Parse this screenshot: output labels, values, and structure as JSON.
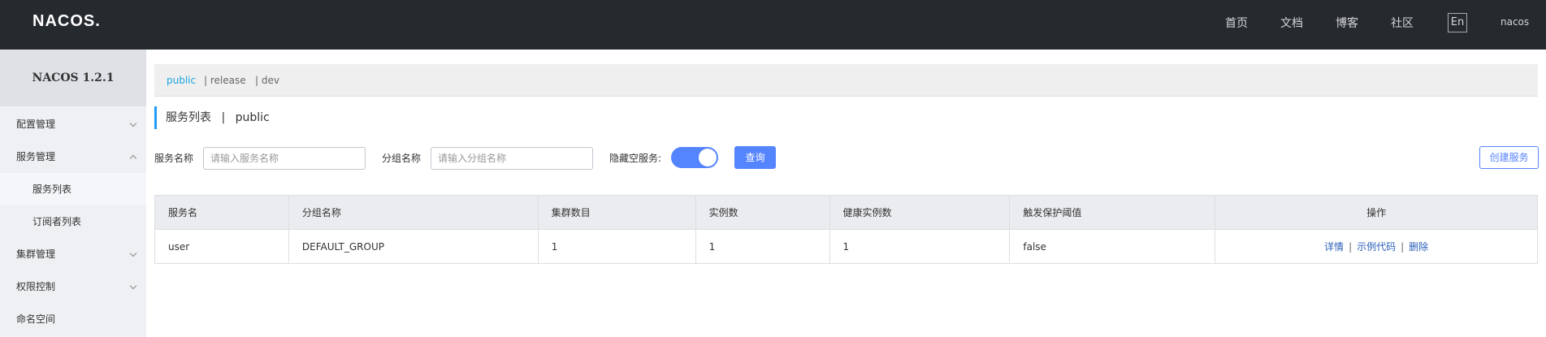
{
  "header": {
    "logo": "NACOS.",
    "nav": [
      "首页",
      "文档",
      "博客",
      "社区"
    ],
    "lang": "En",
    "user": "nacos"
  },
  "sidebar": {
    "title": "NACOS 1.2.1",
    "items": [
      {
        "label": "配置管理"
      },
      {
        "label": "服务管理"
      },
      {
        "label": "服务列表"
      },
      {
        "label": "订阅者列表"
      },
      {
        "label": "集群管理"
      },
      {
        "label": "权限控制"
      },
      {
        "label": "命名空间"
      }
    ]
  },
  "namespaces": {
    "items": [
      "public",
      "| release",
      "| dev"
    ],
    "active": "public"
  },
  "page": {
    "title": "服务列表",
    "separator": "|",
    "namespace": "public"
  },
  "filters": {
    "service_label": "服务名称",
    "service_placeholder": "请输入服务名称",
    "group_label": "分组名称",
    "group_placeholder": "请输入分组名称",
    "hide_empty_label": "隐藏空服务:",
    "hide_empty_on": true,
    "query_button": "查询",
    "create_button": "创建服务"
  },
  "table": {
    "headers": [
      "服务名",
      "分组名称",
      "集群数目",
      "实例数",
      "健康实例数",
      "触发保护阈值",
      "操作"
    ],
    "rows": [
      {
        "cells": [
          "user",
          "DEFAULT_GROUP",
          "1",
          "1",
          "1",
          "false"
        ],
        "actions": [
          "详情",
          "示例代码",
          "删除"
        ],
        "action_separator": "|"
      }
    ]
  },
  "colors": {
    "topbar": "#252a2f",
    "primary": "#5584ff",
    "link": "#2a5fb8",
    "active_namespace": "#1ba5e0"
  }
}
